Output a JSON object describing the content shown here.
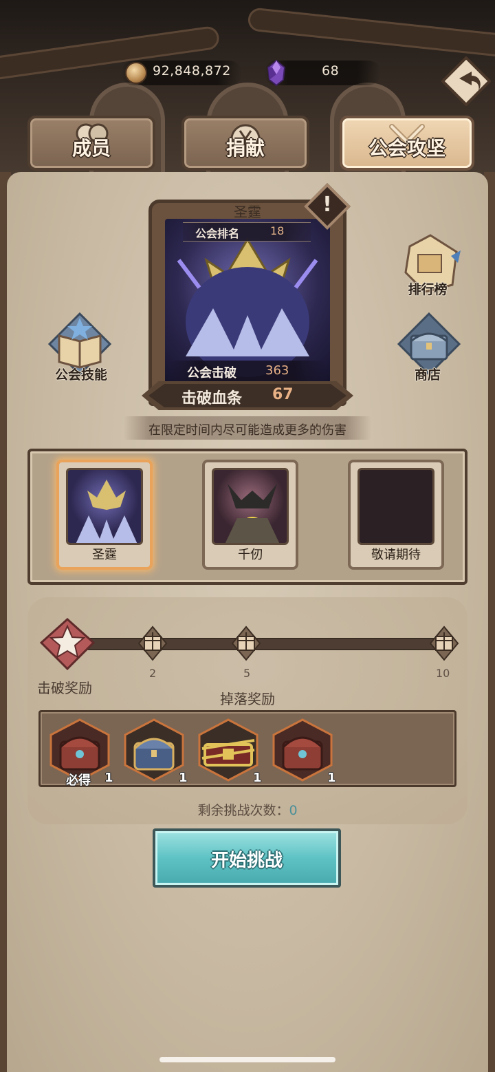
{
  "currency": {
    "gold_value": "92,848,872",
    "gem_value": "68",
    "gold_icon": "coin-icon",
    "gem_icon": "purple-crystal-icon"
  },
  "tabs": [
    {
      "label": "成员",
      "icon": "members-icon",
      "active": false
    },
    {
      "label": "捐献",
      "icon": "yen-coin-icon",
      "active": false
    },
    {
      "label": "公会攻坚",
      "icon": "crossed-swords-icon",
      "active": true
    }
  ],
  "boss": {
    "name": "圣霆",
    "rank_label": "公会排名",
    "rank_value": "18",
    "kills_label": "公会击破",
    "kills_value": "363",
    "hp_label": "击破血条",
    "hp_value": "67",
    "hint": "在限定时间内尽可能造成更多的伤害"
  },
  "side_buttons": {
    "leaderboard": "排行榜",
    "shop": "商店",
    "guild_skills": "公会技能"
  },
  "boss_list": [
    {
      "label": "圣霆",
      "selected": true
    },
    {
      "label": "千仞",
      "selected": false
    },
    {
      "label": "敬请期待",
      "selected": false
    }
  ],
  "rewards": {
    "kill_reward_label": "击破奖励",
    "drop_reward_label": "掉落奖励",
    "milestones": [
      "2",
      "5",
      "10"
    ],
    "progress": 0.0,
    "items": [
      {
        "icon": "red-chest-icon",
        "tag": "必得",
        "count": "1"
      },
      {
        "icon": "blue-chest-icon",
        "tag": "",
        "count": "1"
      },
      {
        "icon": "gold-red-chest-icon",
        "tag": "",
        "count": "1"
      },
      {
        "icon": "red-chest-icon",
        "tag": "",
        "count": "1"
      }
    ]
  },
  "attempts": {
    "label": "剩余挑战次数：",
    "value": "0"
  },
  "start_button": "开始挑战",
  "colors": {
    "accent_teal": "#5ec2c4",
    "highlight_orange": "#e9a35a",
    "value_orange": "#e8b186"
  }
}
